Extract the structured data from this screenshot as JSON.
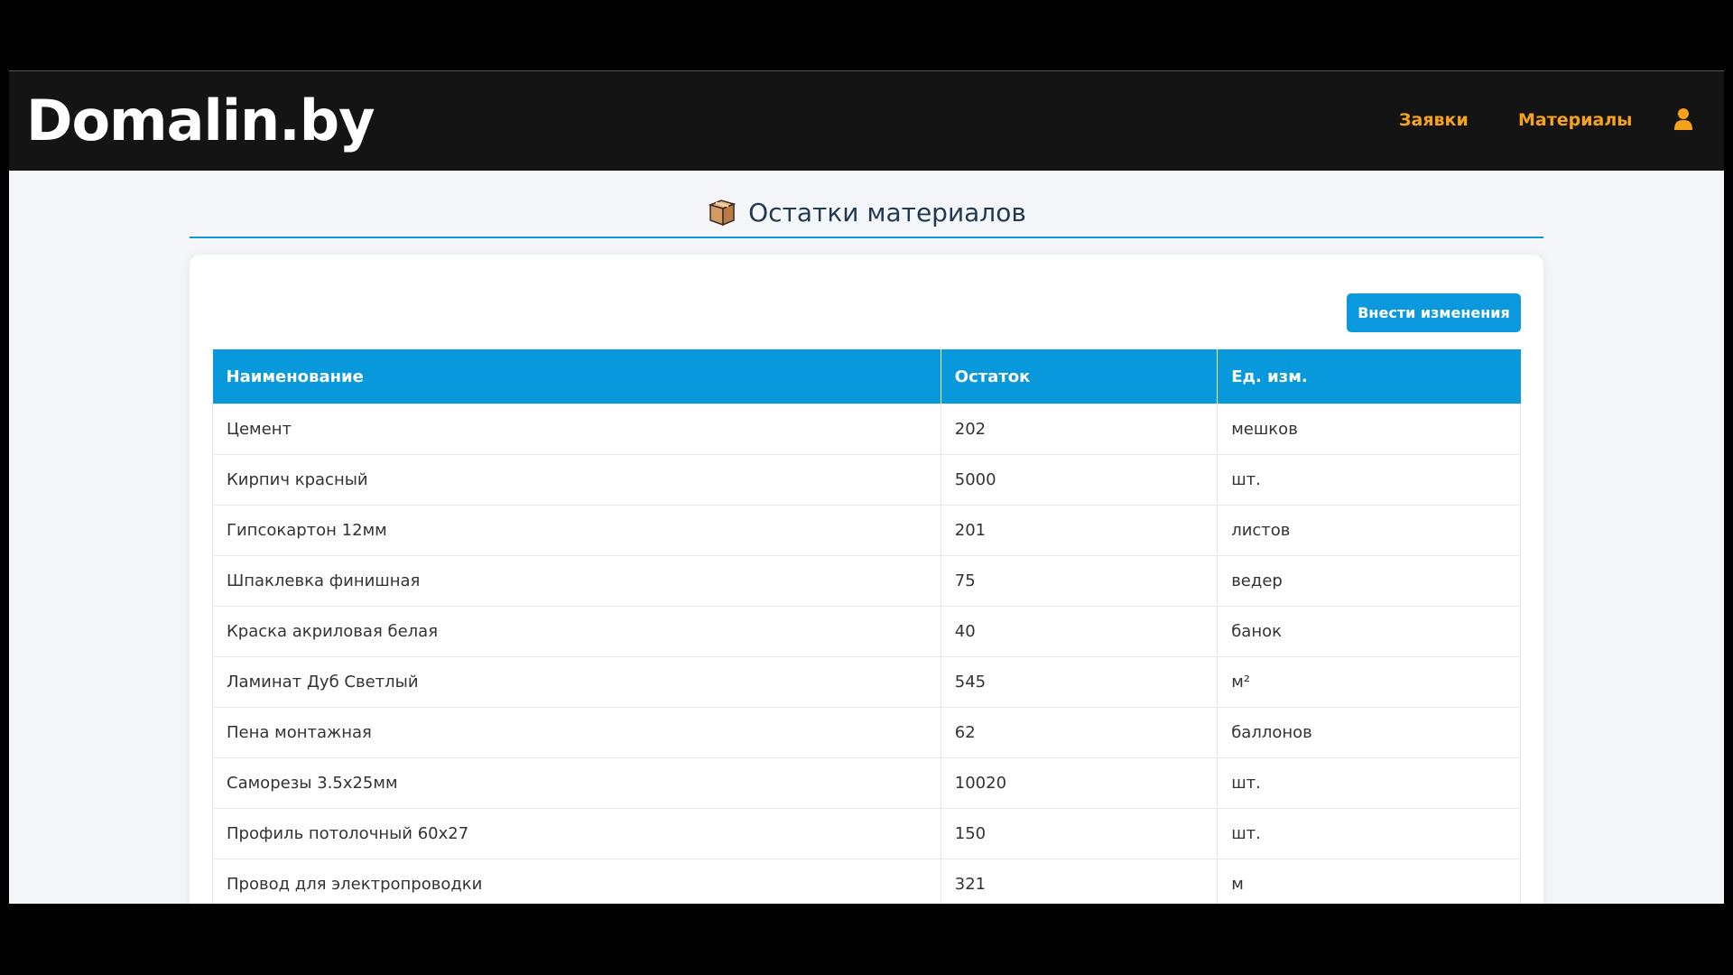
{
  "navbar": {
    "brand": "Domalin.by",
    "links": [
      {
        "label": "Заявки"
      },
      {
        "label": "Материалы"
      }
    ],
    "user_icon": "user-icon",
    "accent_color": "#f7a21b"
  },
  "page": {
    "title": "Остатки материалов",
    "title_icon": "box-icon"
  },
  "toolbar": {
    "edit_label": "Внести изменения"
  },
  "table": {
    "headers": [
      "Наименование",
      "Остаток",
      "Ед. изм."
    ],
    "rows": [
      {
        "name": "Цемент",
        "qty": "202",
        "unit": "мешков"
      },
      {
        "name": "Кирпич красный",
        "qty": "5000",
        "unit": "шт."
      },
      {
        "name": "Гипсокартон 12мм",
        "qty": "201",
        "unit": "листов"
      },
      {
        "name": "Шпаклевка финишная",
        "qty": "75",
        "unit": "ведер"
      },
      {
        "name": "Краска акриловая белая",
        "qty": "40",
        "unit": "банок"
      },
      {
        "name": "Ламинат Дуб Светлый",
        "qty": "545",
        "unit": "м²"
      },
      {
        "name": "Пена монтажная",
        "qty": "62",
        "unit": "баллонов"
      },
      {
        "name": "Саморезы 3.5x25мм",
        "qty": "10020",
        "unit": "шт."
      },
      {
        "name": "Профиль потолочный 60x27",
        "qty": "150",
        "unit": "шт."
      },
      {
        "name": "Провод для электропроводки",
        "qty": "321",
        "unit": "м"
      }
    ]
  },
  "colors": {
    "primary": "#0898dc",
    "navbar_bg": "#141414",
    "page_bg": "#f4f6f9",
    "title_color": "#1f3a52"
  }
}
